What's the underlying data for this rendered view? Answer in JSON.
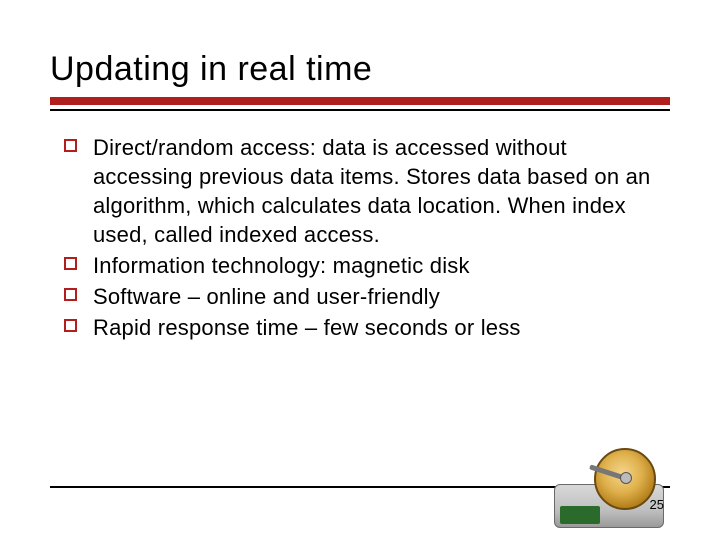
{
  "title": "Updating in real time",
  "bullets": [
    "Direct/random access: data is accessed without accessing previous data items. Stores data based on an algorithm, which calculates data location. When index used, called indexed access.",
    "Information technology: magnetic disk",
    "Software – online and user-friendly",
    "Rapid response time – few seconds or less"
  ],
  "page_number": "25",
  "theme": {
    "accent": "#b01e1e"
  }
}
